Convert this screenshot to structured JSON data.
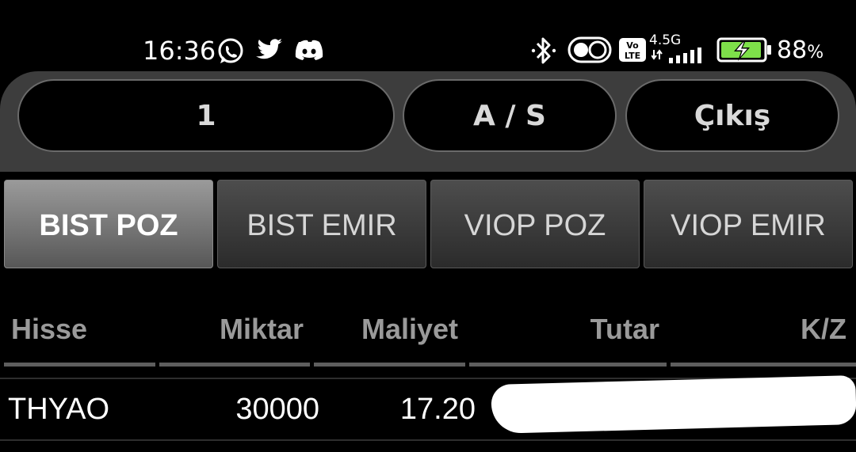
{
  "status_bar": {
    "time": "16:36",
    "notification_icons": [
      "whatsapp-icon",
      "twitter-icon",
      "discord-icon"
    ],
    "system_icons": [
      "bluetooth-icon",
      "toggle-icon",
      "volte-icon",
      "signal-icon",
      "battery-charging-icon"
    ],
    "volte_label": "Vo\nLTE",
    "network_type": "4.5G",
    "battery_percent": "88",
    "battery_unit": "%",
    "battery_color": "#7ee04a"
  },
  "top_bar": {
    "account_button": "1",
    "buy_sell_button": "A / S",
    "exit_button": "Çıkış"
  },
  "tabs": [
    {
      "label": "BIST POZ",
      "active": true
    },
    {
      "label": "BIST EMIR",
      "active": false
    },
    {
      "label": "VIOP POZ",
      "active": false
    },
    {
      "label": "VIOP EMIR",
      "active": false
    }
  ],
  "table": {
    "columns": [
      "Hisse",
      "Miktar",
      "Maliyet",
      "Tutar",
      "K/Z"
    ],
    "rows": [
      {
        "hisse": "THYAO",
        "miktar": "30000",
        "maliyet": "17.20",
        "tutar": "",
        "kz": ""
      }
    ]
  },
  "colors": {
    "background": "#000000",
    "panel": "#3d3d3d",
    "profit_green": "#3ec93e",
    "header_gray": "#9a9a9a"
  }
}
